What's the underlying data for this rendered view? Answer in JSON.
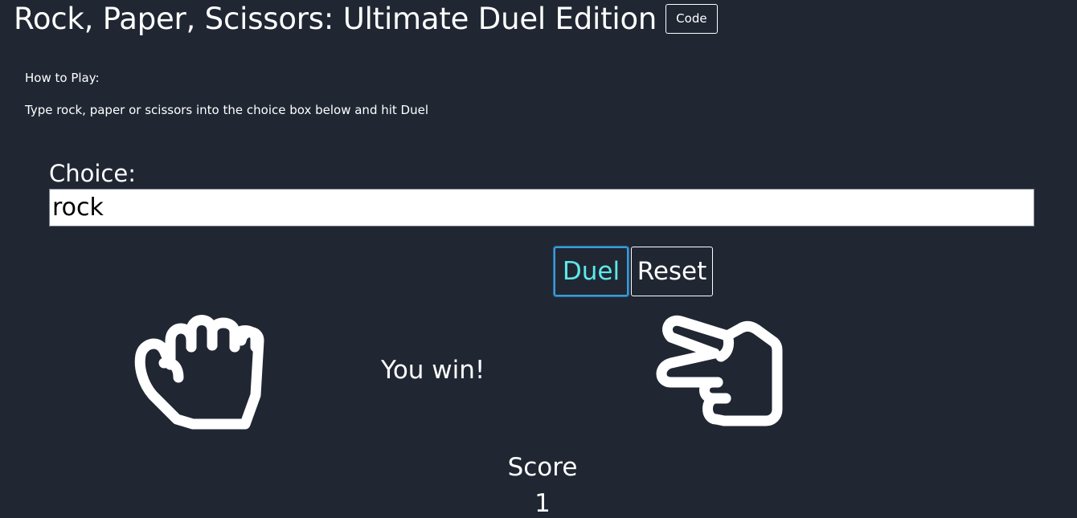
{
  "header": {
    "title": "Rock, Paper, Scissors: Ultimate Duel Edition",
    "code_label": "Code"
  },
  "instructions": {
    "heading": "How to Play:",
    "text": "Type rock, paper or scissors into the choice box below and hit Duel"
  },
  "choice": {
    "label": "Choice:",
    "value": "rock"
  },
  "buttons": {
    "duel_label": "Duel",
    "reset_label": "Reset"
  },
  "hands": {
    "player_icon": "hand-rock-icon",
    "computer_icon": "hand-scissors-icon"
  },
  "result": {
    "message": "You win!"
  },
  "score": {
    "label": "Score",
    "value": "1"
  },
  "colors": {
    "background": "#202733",
    "text": "#ffffff",
    "duel_accent": "#5ee8ea",
    "duel_border": "#3a9bd8"
  }
}
